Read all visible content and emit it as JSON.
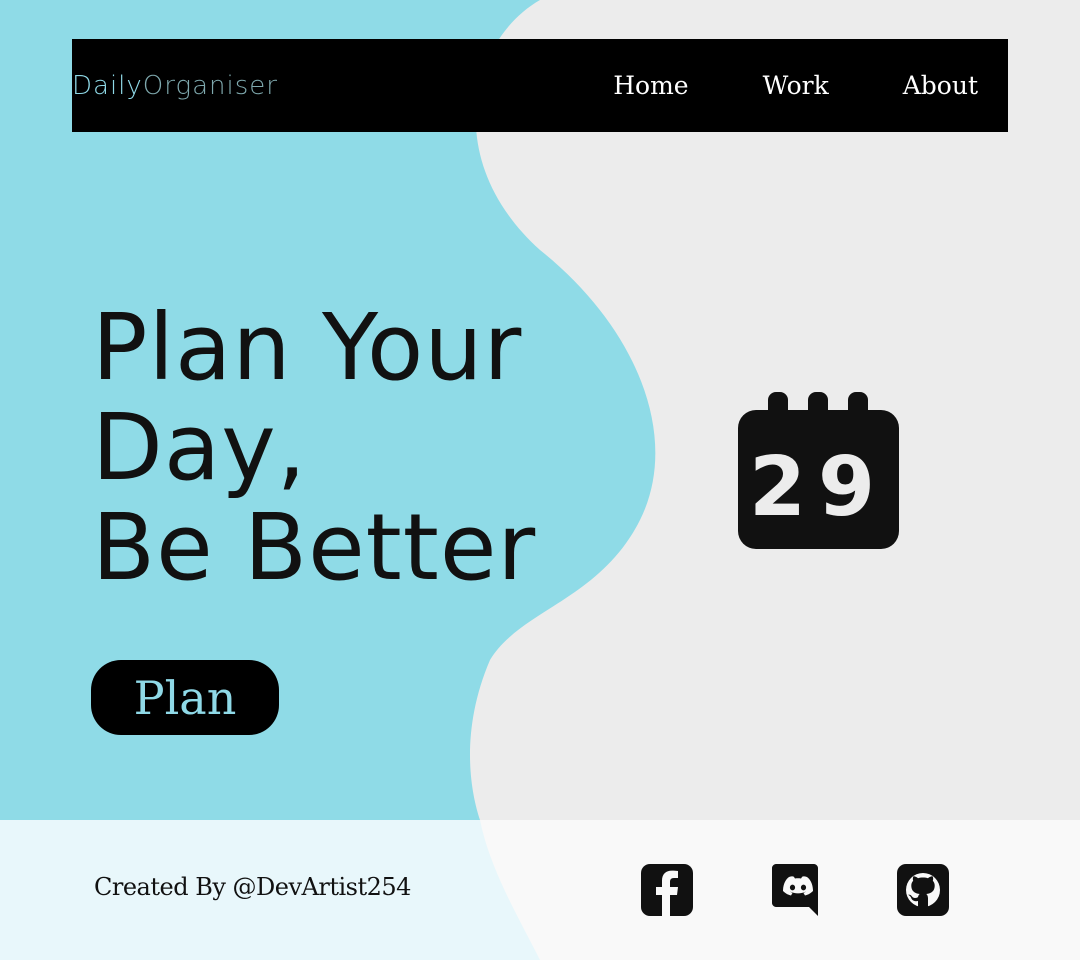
{
  "brand": {
    "part1": "Daily",
    "part2": "Organiser"
  },
  "nav": {
    "items": [
      "Home",
      "Work",
      "About"
    ]
  },
  "hero": {
    "line1": "Plan Your",
    "line2": "Day,",
    "line3": "Be Better"
  },
  "cta": {
    "label": "Plan"
  },
  "calendar": {
    "day": "29",
    "icon": "calendar-icon"
  },
  "footer": {
    "credit": "Created By  @DevArtist254",
    "social": [
      "facebook-icon",
      "discord-icon",
      "github-icon"
    ]
  },
  "colors": {
    "accent": "#8fd9e7",
    "background": "#ececec",
    "footer_left": "#e8f7fb",
    "footer_right": "#f9f9f9",
    "dark": "#111111"
  }
}
